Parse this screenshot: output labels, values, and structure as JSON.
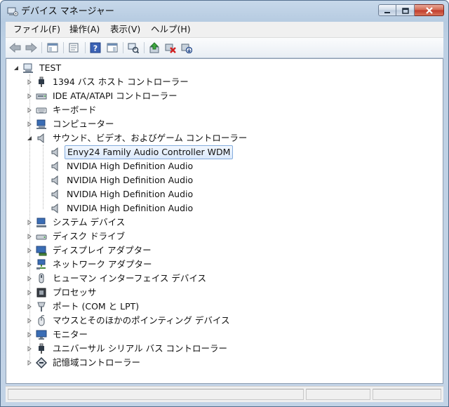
{
  "window": {
    "title": "デバイス マネージャー",
    "buttons": {
      "minimize": "minimize-icon",
      "maximize": "maximize-icon",
      "close": "close-icon"
    }
  },
  "menu": [
    {
      "label": "ファイル(F)"
    },
    {
      "label": "操作(A)"
    },
    {
      "label": "表示(V)"
    },
    {
      "label": "ヘルプ(H)"
    }
  ],
  "toolbar": {
    "icons": [
      "back-icon",
      "forward-icon",
      "show-hide-console-tree-icon",
      "properties-icon",
      "help-icon",
      "action-pane-icon",
      "scan-hardware-icon",
      "update-driver-icon",
      "uninstall-icon",
      "disable-device-icon"
    ]
  },
  "tree": {
    "root": {
      "label": "TEST",
      "icon": "computer-icon",
      "expanded": true
    },
    "categories": [
      {
        "label": "1394 バス ホスト コントローラー",
        "icon": "usb-plug-icon"
      },
      {
        "label": "IDE ATA/ATAPI コントローラー",
        "icon": "ide-controller-icon"
      },
      {
        "label": "キーボード",
        "icon": "keyboard-icon"
      },
      {
        "label": "コンピューター",
        "icon": "computer-icon"
      },
      {
        "label": "サウンド、ビデオ、およびゲーム コントローラー",
        "icon": "speaker-icon",
        "expanded": true,
        "children": [
          {
            "label": "Envy24 Family Audio Controller WDM",
            "icon": "speaker-icon",
            "selected": true
          },
          {
            "label": "NVIDIA High Definition Audio",
            "icon": "speaker-icon"
          },
          {
            "label": "NVIDIA High Definition Audio",
            "icon": "speaker-icon"
          },
          {
            "label": "NVIDIA High Definition Audio",
            "icon": "speaker-icon"
          },
          {
            "label": "NVIDIA High Definition Audio",
            "icon": "speaker-icon"
          }
        ]
      },
      {
        "label": "システム デバイス",
        "icon": "system-devices-icon"
      },
      {
        "label": "ディスク ドライブ",
        "icon": "disk-drive-icon"
      },
      {
        "label": "ディスプレイ アダプター",
        "icon": "display-adapter-icon"
      },
      {
        "label": "ネットワーク アダプター",
        "icon": "network-adapter-icon"
      },
      {
        "label": "ヒューマン インターフェイス デバイス",
        "icon": "hid-icon"
      },
      {
        "label": "プロセッサ",
        "icon": "processor-icon"
      },
      {
        "label": "ポート (COM と LPT)",
        "icon": "port-icon"
      },
      {
        "label": "マウスとそのほかのポインティング デバイス",
        "icon": "mouse-icon"
      },
      {
        "label": "モニター",
        "icon": "monitor-icon"
      },
      {
        "label": "ユニバーサル シリアル バス コントローラー",
        "icon": "usb-plug-icon"
      },
      {
        "label": "記憶域コントローラー",
        "icon": "storage-controller-icon"
      }
    ]
  },
  "colors": {
    "titlebar": "#c7d8ea",
    "selection_border": "#84acdd",
    "selection_fill": "#dbe9fb"
  }
}
